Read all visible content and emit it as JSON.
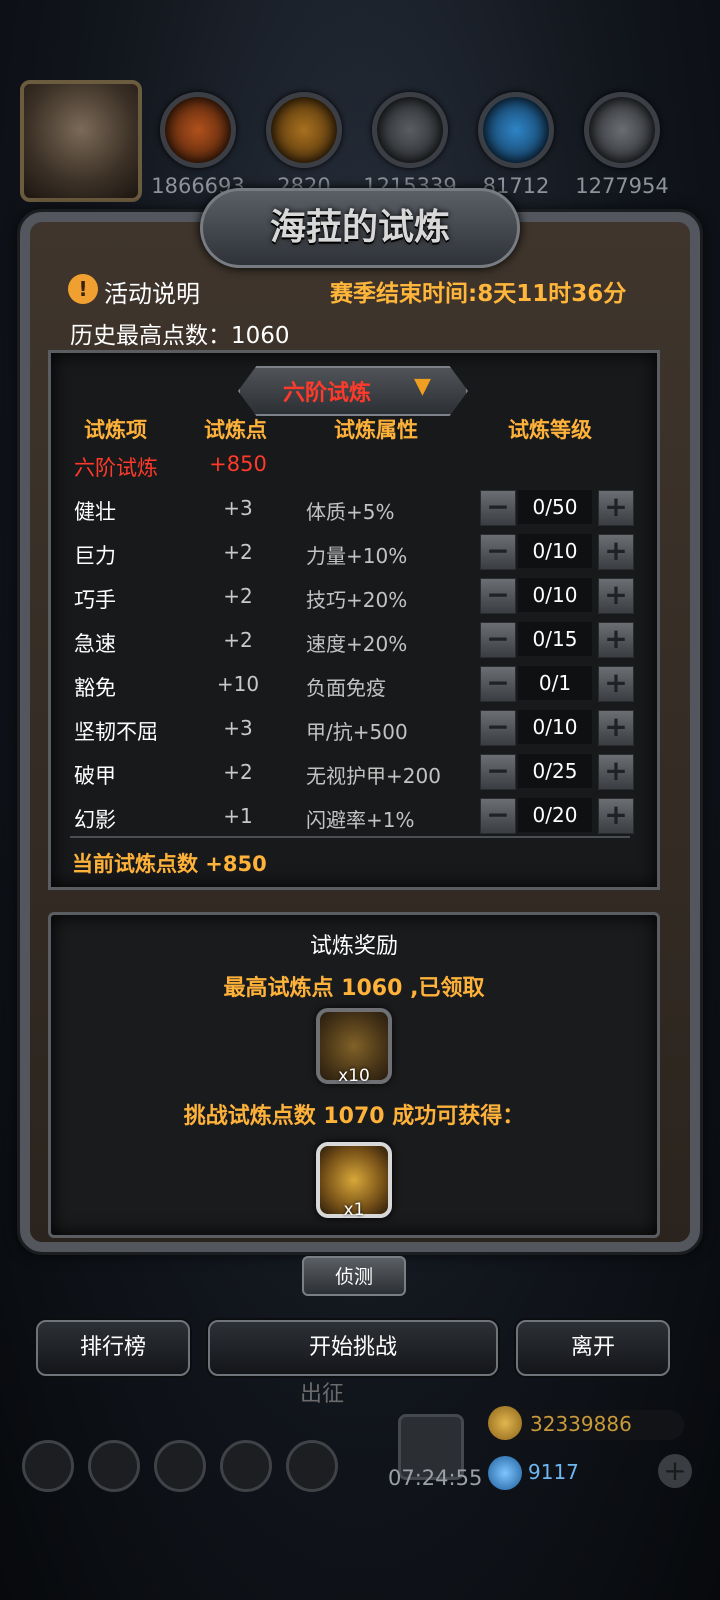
{
  "top_resources": [
    {
      "icon": "meat-icon",
      "value": "1866693",
      "color": "#b0501c"
    },
    {
      "icon": "wood-icon",
      "value": "2820",
      "color": "#a8701f"
    },
    {
      "icon": "iron-icon",
      "value": "1215339",
      "color": "#5a5e63"
    },
    {
      "icon": "crystal-icon",
      "value": "81712",
      "color": "#2e84c6"
    },
    {
      "icon": "steel-icon",
      "value": "1277954",
      "color": "#6a6d72"
    }
  ],
  "dialog": {
    "title": "海菈的试炼",
    "activity_info": "活动说明",
    "season_end": "赛季结束时间:8天11时36分",
    "best_points": "历史最高点数：1060"
  },
  "trial": {
    "tier_selected": "六阶试炼",
    "headers": {
      "item": "试炼项",
      "points": "试炼点",
      "attribute": "试炼属性",
      "level": "试炼等级"
    },
    "tier_row": {
      "name": "六阶试炼",
      "points": "+850"
    },
    "rows": [
      {
        "name": "健壮",
        "points": "+3",
        "attribute": "体质+5%",
        "level": "0/50"
      },
      {
        "name": "巨力",
        "points": "+2",
        "attribute": "力量+10%",
        "level": "0/10"
      },
      {
        "name": "巧手",
        "points": "+2",
        "attribute": "技巧+20%",
        "level": "0/10"
      },
      {
        "name": "急速",
        "points": "+2",
        "attribute": "速度+20%",
        "level": "0/15"
      },
      {
        "name": "豁免",
        "points": "+10",
        "attribute": "负面免疫",
        "level": "0/1"
      },
      {
        "name": "坚韧不屈",
        "points": "+3",
        "attribute": "甲/抗+500",
        "level": "0/10"
      },
      {
        "name": "破甲",
        "points": "+2",
        "attribute": "无视护甲+200",
        "level": "0/25"
      },
      {
        "name": "幻影",
        "points": "+1",
        "attribute": "闪避率+1%",
        "level": "0/20"
      }
    ],
    "current_points": "当前试炼点数 +850"
  },
  "reward": {
    "title": "试炼奖励",
    "claimed_text": "最高试炼点 1060 ,已领取",
    "claimed_qty": "x10",
    "challenge_text": "挑战试炼点数 1070 成功可获得：",
    "challenge_qty": "x1"
  },
  "buttons": {
    "detect": "侦测",
    "ranking": "排行榜",
    "start": "开始挑战",
    "leave": "离开"
  },
  "background": {
    "expedition": "出征",
    "timer": "07:24:55",
    "gold": "32339886",
    "gems": "9117"
  }
}
